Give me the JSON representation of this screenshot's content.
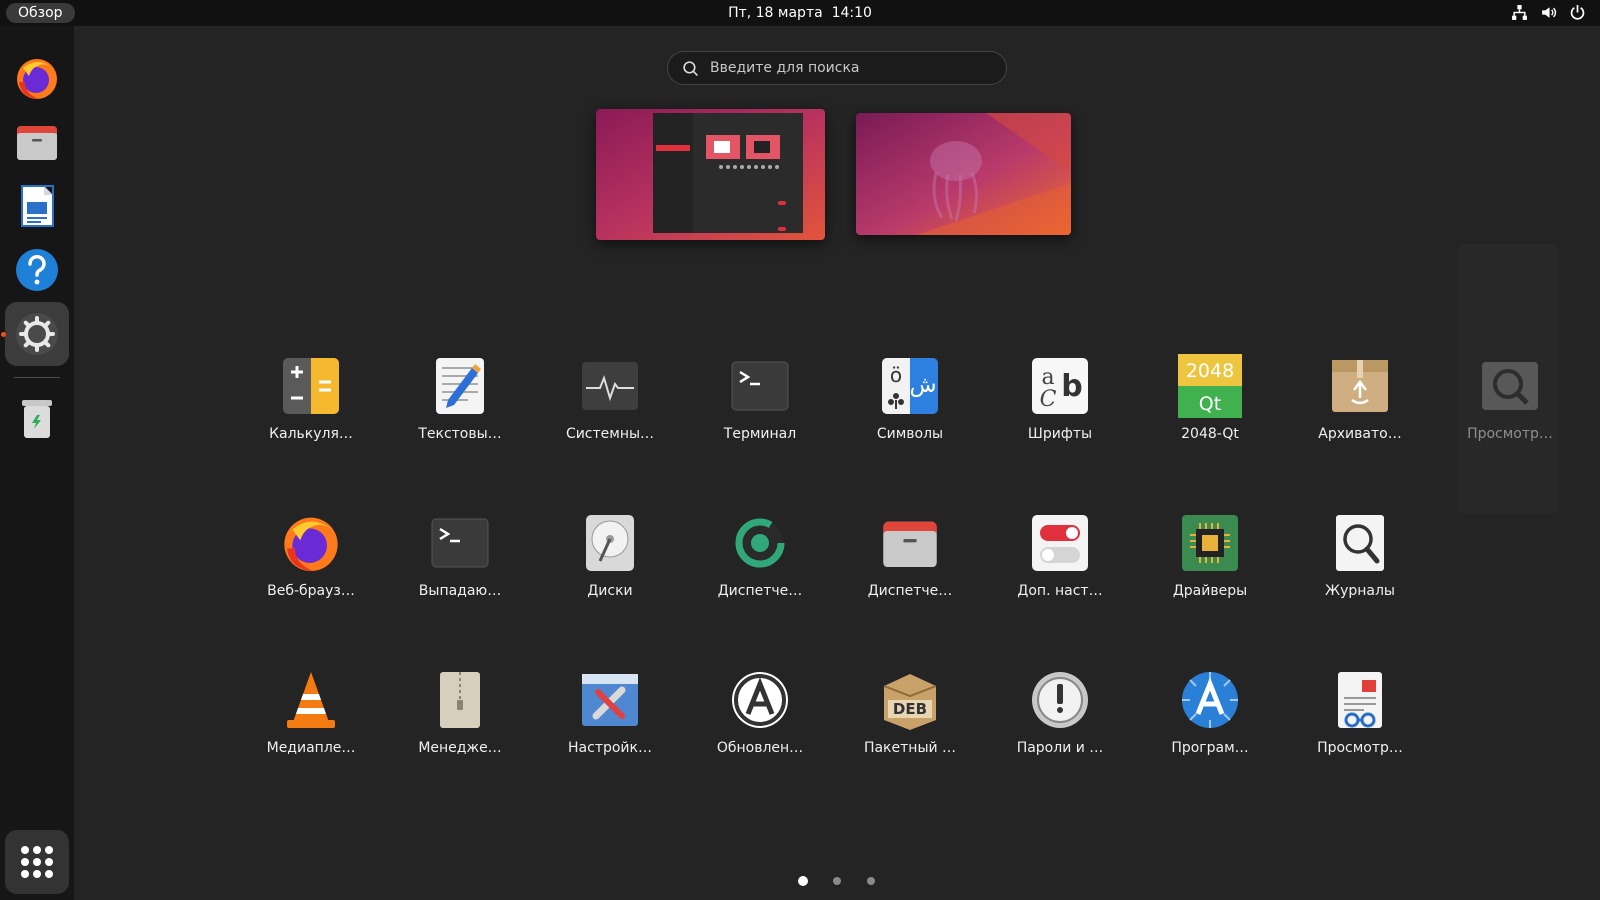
{
  "topbar": {
    "activities": "Обзор",
    "clock": "Пт, 18 марта  14:10"
  },
  "search": {
    "placeholder": "Введите для поиска"
  },
  "dock": {
    "items": [
      "firefox-icon",
      "files-icon",
      "writer-icon",
      "help-icon",
      "settings-icon",
      "trash-icon",
      "show-apps-icon"
    ],
    "active": "settings"
  },
  "apps": {
    "row1": [
      "Калькуля…",
      "Текстовы…",
      "Системны…",
      "Терминал",
      "Символы",
      "Шрифты",
      "2048-Qt",
      "Архивато…"
    ],
    "row2": [
      "Веб-брауз…",
      "Выпадаю…",
      "Диски",
      "Диспетче…",
      "Диспетче…",
      "Доп. наст…",
      "Драйверы",
      "Журналы"
    ],
    "row3": [
      "Медиапле…",
      "Менедже…",
      "Настройк…",
      "Обновлен…",
      "Пакетный …",
      "Пароли и …",
      "Програм…",
      "Просмотр…"
    ],
    "peek": "Просмотр…"
  },
  "icon_texts": {
    "game_2048": "2048",
    "game_qt": "Qt",
    "deb": "DEB",
    "fonts_a": "a",
    "fonts_b": "b",
    "fonts_c": "C",
    "chars_o": "ö",
    "chars_ar": "ش"
  },
  "pages": {
    "count": 3,
    "current": 1
  },
  "colors": {
    "accent": "#e95420",
    "background": "#242424",
    "topbar": "#111111",
    "dock": "#161616"
  }
}
